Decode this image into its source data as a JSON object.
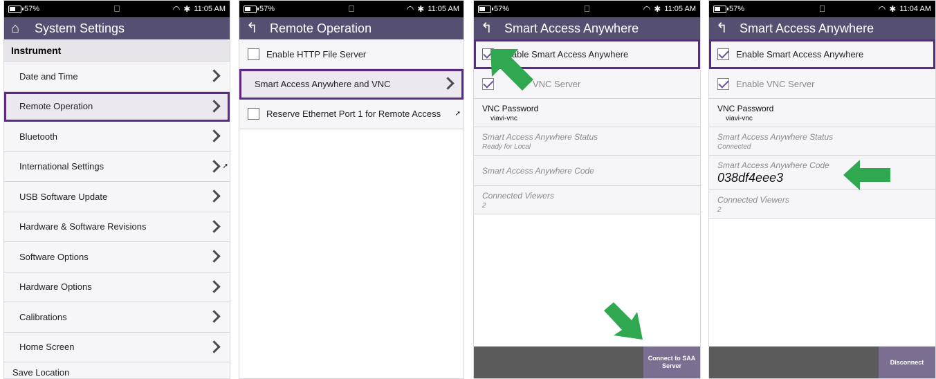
{
  "colors": {
    "title_bar": "#554f71",
    "highlight": "#5b2a86",
    "arrow": "#2fa84f"
  },
  "panels": [
    {
      "status": {
        "battery": "57%",
        "time": "11:05 AM"
      },
      "title": "System Settings",
      "title_icon": "home-icon",
      "section": "Instrument",
      "items": [
        {
          "label": "Date and Time"
        },
        {
          "label": "Remote Operation"
        },
        {
          "label": "Bluetooth"
        },
        {
          "label": "International Settings"
        },
        {
          "label": "USB Software Update"
        },
        {
          "label": "Hardware & Software Revisions"
        },
        {
          "label": "Software Options"
        },
        {
          "label": "Hardware Options"
        },
        {
          "label": "Calibrations"
        },
        {
          "label": "Home Screen"
        },
        {
          "label": "Save Location"
        }
      ]
    },
    {
      "status": {
        "battery": "57%",
        "time": "11:05 AM"
      },
      "title": "Remote Operation",
      "items": [
        {
          "label": "Enable HTTP File Server"
        },
        {
          "label": "Smart Access Anywhere and VNC"
        },
        {
          "label": "Reserve Ethernet Port 1 for Remote Access"
        }
      ]
    },
    {
      "status": {
        "battery": "57%",
        "time": "11:05 AM"
      },
      "title": "Smart Access Anywhere",
      "enable_saa": "Enable Smart Access Anywhere",
      "enable_vnc": "VNC Server",
      "vnc_password_label": "VNC Password",
      "vnc_password_value": "viavi-vnc",
      "status_label": "Smart Access Anywhere Status",
      "status_value": "Ready for Local",
      "code_label": "Smart Access Anywhere Code",
      "viewers_label": "Connected Viewers",
      "viewers_value": "2",
      "footer_button": "Connect to SAA Server"
    },
    {
      "status": {
        "battery": "57%",
        "time": "11:04 AM"
      },
      "title": "Smart Access Anywhere",
      "enable_saa": "Enable Smart Access Anywhere",
      "enable_vnc": "Enable VNC Server",
      "vnc_password_label": "VNC Password",
      "vnc_password_value": "viavi-vnc",
      "status_label": "Smart Access Anywhere Status",
      "status_value": "Connected",
      "code_label": "Smart Access Anywhere Code",
      "code_value": "038df4eee3",
      "viewers_label": "Connected Viewers",
      "viewers_value": "2",
      "footer_button": "Disconnect"
    }
  ]
}
